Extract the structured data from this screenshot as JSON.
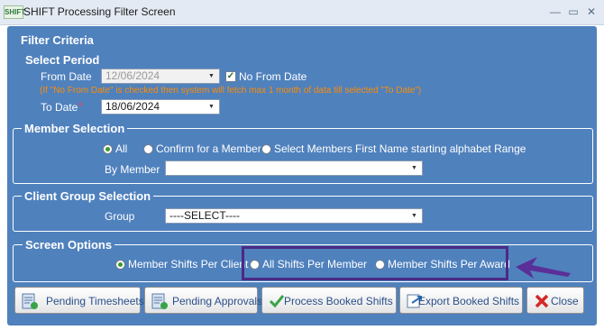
{
  "window": {
    "title": "SHIFT Processing Filter Screen",
    "app_icon_text": "SHIFT"
  },
  "filter_criteria": {
    "legend": "Filter Criteria"
  },
  "select_period": {
    "legend": "Select Period",
    "from_date_label": "From Date",
    "from_date_value": "12/06/2024",
    "no_from_date_label": "No From Date",
    "no_from_date_checked": true,
    "hint": "(If \"No From Date\" is checked then system will fetch max 1 month of data till selected \"To Date\")",
    "to_date_label": "To Date",
    "to_date_value": "18/06/2024"
  },
  "member_selection": {
    "legend": "Member Selection",
    "options": [
      "All",
      "Confirm for a Member",
      "Select Members First Name starting alphabet Range"
    ],
    "selected": "All",
    "by_member_label": "By Member",
    "by_member_value": ""
  },
  "client_group": {
    "legend": "Client Group Selection",
    "group_label": "Group",
    "group_value": "----SELECT----"
  },
  "screen_options": {
    "legend": "Screen Options",
    "options": [
      "Member Shifts Per Client",
      "All Shifts Per Member",
      "Member Shifts Per Award"
    ],
    "selected": "Member Shifts Per Client"
  },
  "buttons": {
    "pending_timesheets": "Pending Timesheets",
    "pending_approvals": "Pending Approvals",
    "process_booked_shifts": "Process Booked Shifts",
    "export_booked_shifts": "Export Booked Shifts",
    "close": "Close"
  },
  "colors": {
    "panel": "#4f81bd",
    "highlight": "#4b2a86",
    "hint": "#ff8c00",
    "button_text": "#2a4f8a"
  }
}
